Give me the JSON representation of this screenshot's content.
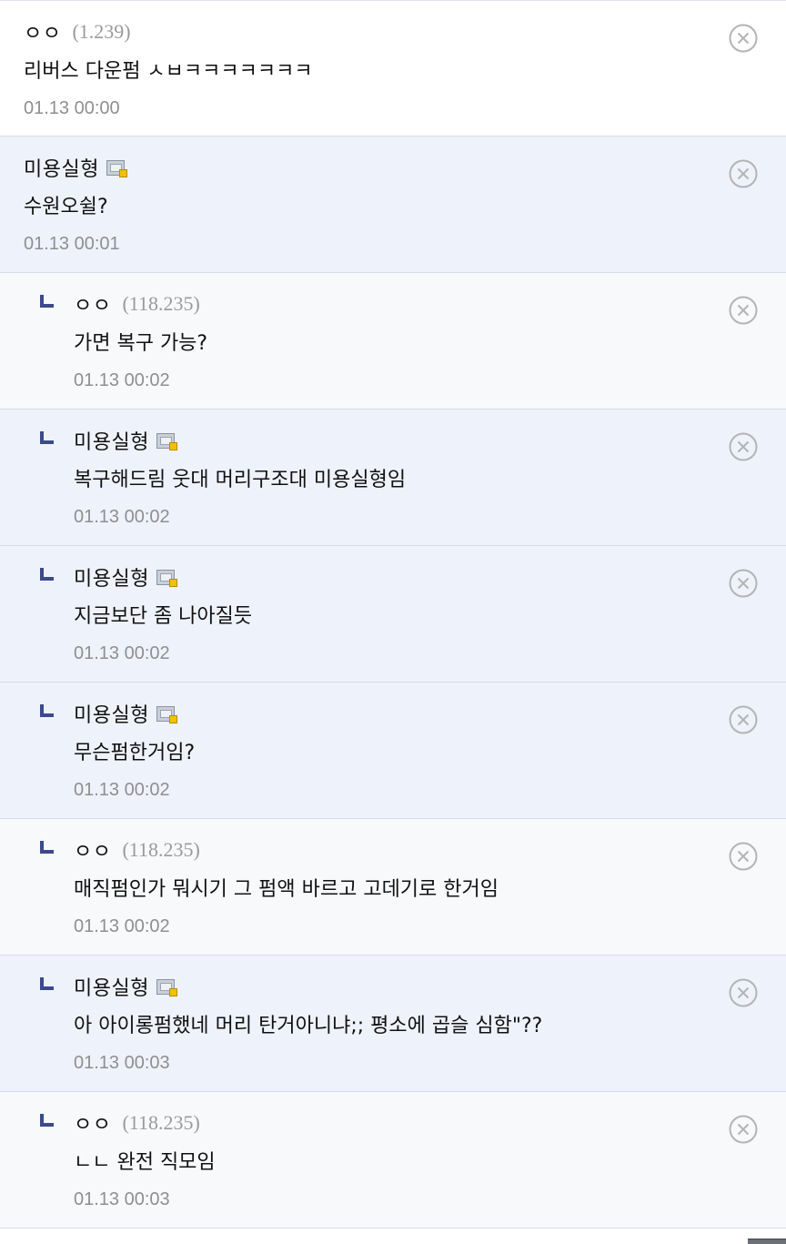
{
  "icons": {
    "delete": "close-circle-icon",
    "badge": "fixed-nick-badge-icon",
    "reply": "reply-arrow-icon"
  },
  "colors": {
    "reply_marker": "#3b4a8c",
    "highlight_bg": "#eef2fb",
    "divider": "#d6dce8"
  },
  "comments": [
    {
      "nick": "ㅇㅇ",
      "ip": "(1.239)",
      "text": "리버스 다운펌 ㅅㅂㅋㅋㅋㅋㅋㅋㅋ",
      "time": "01.13 00:00"
    },
    {
      "nick": "미용실형",
      "ip": "",
      "text": "수원오쉴?",
      "time": "01.13 00:01"
    },
    {
      "nick": "ㅇㅇ",
      "ip": "(118.235)",
      "text": "가면 복구 가능?",
      "time": "01.13 00:02"
    },
    {
      "nick": "미용실형",
      "ip": "",
      "text": "복구해드림 웃대 머리구조대 미용실형임",
      "time": "01.13 00:02"
    },
    {
      "nick": "미용실형",
      "ip": "",
      "text": "지금보단 좀 나아질듯",
      "time": "01.13 00:02"
    },
    {
      "nick": "미용실형",
      "ip": "",
      "text": "무슨펌한거임?",
      "time": "01.13 00:02"
    },
    {
      "nick": "ㅇㅇ",
      "ip": "(118.235)",
      "text": "매직펌인가 뭐시기 그 펌액 바르고 고데기로 한거임",
      "time": "01.13 00:02"
    },
    {
      "nick": "미용실형",
      "ip": "",
      "text": "아 아이롱펌했네 머리 탄거아니냐;; 평소에 곱슬 심함\"??",
      "time": "01.13 00:03"
    },
    {
      "nick": "ㅇㅇ",
      "ip": "(118.235)",
      "text": "ㄴㄴ 완전 직모임",
      "time": "01.13 00:03"
    }
  ]
}
